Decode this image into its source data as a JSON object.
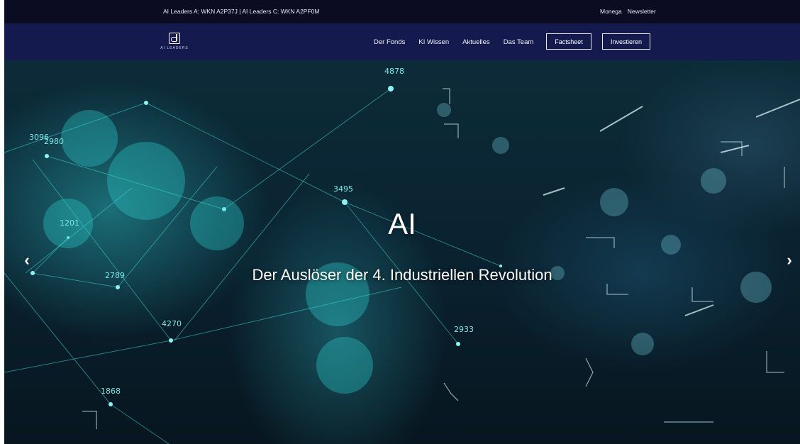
{
  "topbar": {
    "wkn_info": "AI Leaders A: WKN A2P37J | AI Leaders C: WKN A2PF0M",
    "links": [
      "Monega",
      "Newsletter"
    ]
  },
  "header": {
    "logo_text": "AI LEADERS",
    "nav_items": [
      "Der Fonds",
      "KI Wissen",
      "Aktuelles",
      "Das Team"
    ],
    "factsheet_label": "Factsheet",
    "invest_label": "Investieren"
  },
  "hero": {
    "title": "AI",
    "subtitle": "Der Auslöser der 4. Industriellen Revolution",
    "prev_arrow": "‹",
    "next_arrow": "›",
    "numbers": [
      "4878",
      "3096",
      "2980",
      "1201",
      "2789",
      "4270",
      "1868",
      "2933",
      "3495"
    ]
  },
  "colors": {
    "topbar_bg": "#0b0b22",
    "navbar_bg": "#141a4d",
    "accent_cyan": "#2fd1d1"
  }
}
